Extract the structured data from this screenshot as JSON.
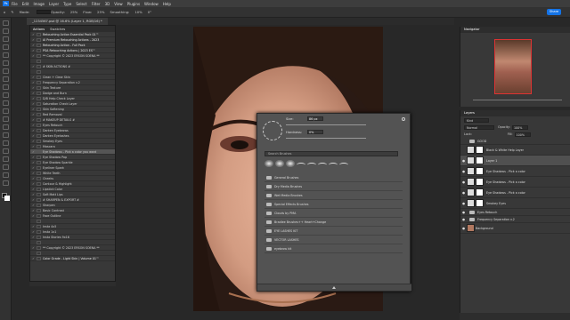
{
  "menubar": {
    "logo": "Ps",
    "items": [
      "File",
      "Edit",
      "Image",
      "Layer",
      "Type",
      "Select",
      "Filter",
      "3D",
      "View",
      "Plugins",
      "Window",
      "Help"
    ]
  },
  "optbar": {
    "mode_label": "Mode:",
    "opacity_label": "Opacity:",
    "opacity": "25%",
    "flow_label": "Flow:",
    "flow": "25%",
    "smoothing_label": "Smoothing:",
    "smoothing": "10%",
    "angle": "0°",
    "share": "Share"
  },
  "tab": {
    "title": "_1234567.psd @ 16.6% (Layer 1, RGB/16) *"
  },
  "actions": {
    "tab_actions": "Actions",
    "tab_swatches": "Swatches",
    "rows": [
      {
        "label": "Retouching Action Essential Pack 01™",
        "check": "✓",
        "type": "folder"
      },
      {
        "label": "AI Premium Retouching Actions - 2023",
        "check": "✓",
        "type": "folder"
      },
      {
        "label": "Retouching Action - Full Pack",
        "check": "✓",
        "type": "folder"
      },
      {
        "label": "PSA Retouching Actions | 2023 ES™",
        "check": "✓",
        "type": "folder"
      },
      {
        "label": "** Copyright © 2023 ERSON SOENA **",
        "check": "✓",
        "type": "item"
      },
      {
        "label": "",
        "check": "",
        "type": "item"
      },
      {
        "label": "# SKIN ACTIONS #",
        "check": "✓",
        "type": "item"
      },
      {
        "label": "",
        "check": "",
        "type": "item"
      },
      {
        "label": "Clean + Clear Skin",
        "check": "✓",
        "type": "item"
      },
      {
        "label": "Frequency Separation v.2",
        "check": "✓",
        "type": "item"
      },
      {
        "label": "Skin Texture",
        "check": "✓",
        "type": "item"
      },
      {
        "label": "Dodge and Burn",
        "check": "✓",
        "type": "item"
      },
      {
        "label": "D/B Help Check Layer",
        "check": "✓",
        "type": "item"
      },
      {
        "label": "Saturation Check Layer",
        "check": "✓",
        "type": "item"
      },
      {
        "label": "Skin Softening",
        "check": "✓",
        "type": "item"
      },
      {
        "label": "Red Removal",
        "check": "✓",
        "type": "item"
      },
      {
        "label": "# MAKEUP DETAILS #",
        "check": "✓",
        "type": "item"
      },
      {
        "label": "Eyes Retouch",
        "check": "✓",
        "type": "item"
      },
      {
        "label": "Darken Eyebrows",
        "check": "✓",
        "type": "item"
      },
      {
        "label": "Darken Eyelashes",
        "check": "✓",
        "type": "item"
      },
      {
        "label": "Smokey Eyes",
        "check": "✓",
        "type": "item"
      },
      {
        "label": "Mascara",
        "check": "✓",
        "type": "item"
      },
      {
        "label": "Eye Shadows - Pick a color you want",
        "check": "✓",
        "type": "sel"
      },
      {
        "label": "Eye Shadow Pop",
        "check": "✓",
        "type": "item"
      },
      {
        "label": "Eye Shadow Sparkle",
        "check": "✓",
        "type": "item"
      },
      {
        "label": "Eyeliner Spark",
        "check": "✓",
        "type": "item"
      },
      {
        "label": "White Teeth",
        "check": "✓",
        "type": "item"
      },
      {
        "label": "Cheeks",
        "check": "✓",
        "type": "item"
      },
      {
        "label": "Contour & Highlight",
        "check": "✓",
        "type": "item"
      },
      {
        "label": "Lipstick Color",
        "check": "✓",
        "type": "item"
      },
      {
        "label": "Soft Matt Lips",
        "check": "✓",
        "type": "item"
      },
      {
        "label": "# SHARPEN & EXPORT #",
        "check": "✓",
        "type": "item"
      },
      {
        "label": "Sharpen",
        "check": "✓",
        "type": "item"
      },
      {
        "label": "Basic Contrast",
        "check": "✓",
        "type": "item"
      },
      {
        "label": "Face Outline",
        "check": "✓",
        "type": "item"
      },
      {
        "label": "",
        "check": "",
        "type": "item"
      },
      {
        "label": "Insta 4x5",
        "check": "✓",
        "type": "item"
      },
      {
        "label": "Insta 1x1",
        "check": "✓",
        "type": "item"
      },
      {
        "label": "Insta Stories 9x16",
        "check": "✓",
        "type": "item"
      },
      {
        "label": "",
        "check": "",
        "type": "item"
      },
      {
        "label": "** Copyright © 2023 ERSON SOENA **",
        "check": "✓",
        "type": "item"
      },
      {
        "label": "",
        "check": "",
        "type": "item"
      },
      {
        "label": "Color Grade - Light Skin | Volume 01™",
        "check": "✓",
        "type": "folder"
      }
    ]
  },
  "brush_panel": {
    "size_label": "Size:",
    "size": "86 px",
    "hardness_label": "Hardness:",
    "hardness": "0%",
    "search_placeholder": "Search Brushes",
    "folders": [
      "General Brushes",
      "Dry Media Brushes",
      "Wet Media Brushes",
      "Special Effects Brushes",
      "Clouds by PMA",
      "Bradlee Brushes++ Heart+Change",
      "EYE LASHES KIT",
      "VECTOR LASHES",
      "eyebrow kit"
    ]
  },
  "navigator": {
    "title": "Navigator"
  },
  "layers": {
    "title": "Layers",
    "kind": "Kind",
    "blend": "Normal",
    "opacity_label": "Opacity:",
    "opacity": "100%",
    "lock_label": "Lock:",
    "fill_label": "Fill:",
    "fill": "100%",
    "items": [
      {
        "name": "GOOD",
        "eye": "",
        "kind": "group"
      },
      {
        "name": "Black & White Help Layer",
        "eye": "",
        "kind": "layer"
      },
      {
        "name": "Layer 1",
        "eye": "●",
        "kind": "sel"
      },
      {
        "name": "Eye Shadows - Pick a color",
        "eye": "●",
        "kind": "layer"
      },
      {
        "name": "Eye Shadows - Pick a color",
        "eye": "●",
        "kind": "layer"
      },
      {
        "name": "Eye Shadows - Pick a color",
        "eye": "●",
        "kind": "layer"
      },
      {
        "name": "Smokey Eyes",
        "eye": "●",
        "kind": "layer"
      },
      {
        "name": "Eyes Retouch",
        "eye": "●",
        "kind": "group"
      },
      {
        "name": "Frequency Separation v.2",
        "eye": "●",
        "kind": "group"
      },
      {
        "name": "Background",
        "eye": "●",
        "kind": "bg"
      }
    ]
  }
}
